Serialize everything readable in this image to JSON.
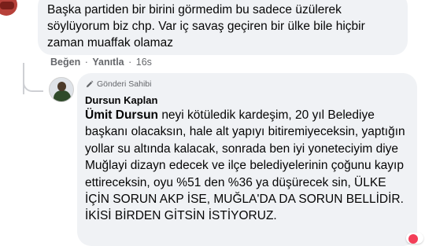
{
  "comment": {
    "text": "Başka partiden bir birini görmedim bu sadece üzülerek söylüyorum biz chp. Var iç savaş geçiren bir ülke bile hiçbir zaman muaffak olamaz",
    "actions": {
      "like_label": "Beğen",
      "reply_label": "Yanıtla",
      "separator": "·",
      "time": "16s"
    }
  },
  "reply": {
    "badge_label": "Gönderi Sahibi",
    "author": "Dursun Kaplan",
    "mention": "Ümit Dursun",
    "text": "neyi kötüledik kardeşim, 20 yıl Belediye başkanı olacaksın, hale alt yapıyı bitiremiyeceksin, yaptığın yollar su altında kalacak, sonrada ben iyi yoneteciyim diye Muğlayi dizayn edecek ve ilçe belediyelerinin çoğunu kayıp ettireceksin, oyu %51 den %36 ya düşürecek sin, ÜLKE İÇİN SORUN AKP İSE, MUĞLA'DA DA SORUN BELLİDİR. İKİSİ BİRDEN GİTSİN İSTİYORUZ."
  },
  "icons": {
    "badge_icon": "pencil-icon",
    "reaction_icon": "heart-reaction-icon"
  }
}
